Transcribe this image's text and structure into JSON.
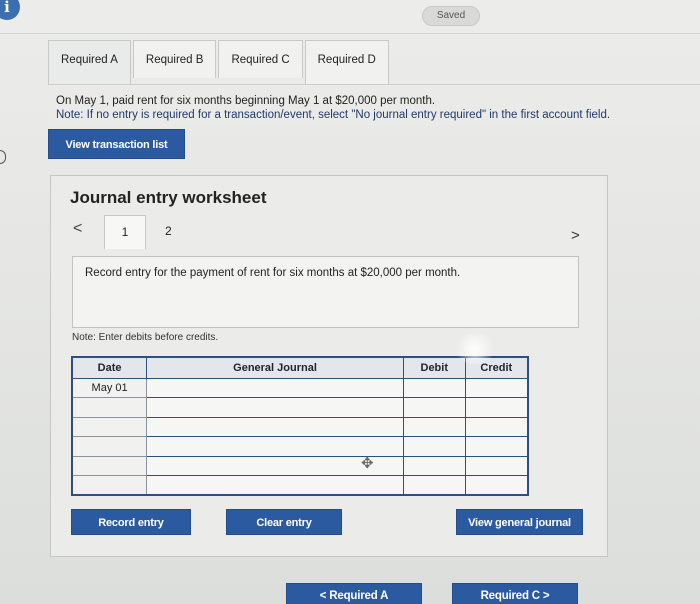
{
  "header": {
    "info_icon": "info-icon",
    "saved_label": "Saved"
  },
  "tabs": [
    {
      "label": "Required A"
    },
    {
      "label": "Required B"
    },
    {
      "label": "Required C"
    },
    {
      "label": "Required D"
    }
  ],
  "problem": {
    "line1": "On May 1, paid rent for six months beginning May 1 at $20,000 per month.",
    "note": "Note: If no entry is required for a transaction/event, select \"No journal entry required\" in the first account field."
  },
  "view_transaction_list_label": "View transaction list",
  "worksheet": {
    "title": "Journal entry worksheet",
    "pager": {
      "prev": "<",
      "current": "1",
      "other": "2",
      "next": ">"
    },
    "record_text": "Record entry for the payment of rent for six months at $20,000 per month.",
    "debits_note": "Note: Enter debits before credits.",
    "table": {
      "headers": {
        "date": "Date",
        "general_journal": "General Journal",
        "debit": "Debit",
        "credit": "Credit"
      },
      "rows": [
        {
          "date": "May 01"
        },
        {
          "date": ""
        },
        {
          "date": ""
        },
        {
          "date": ""
        },
        {
          "date": ""
        },
        {
          "date": ""
        }
      ]
    },
    "buttons": {
      "record": "Record entry",
      "clear": "Clear entry",
      "general": "View general journal"
    }
  },
  "navigation": {
    "prev_label": "<  Required A",
    "next_label": "Required C  >"
  }
}
